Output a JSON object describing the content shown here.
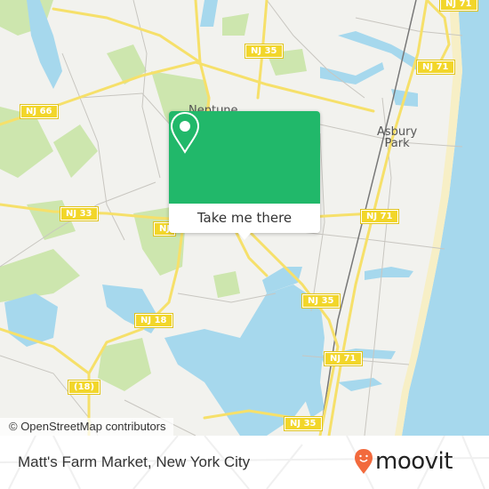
{
  "map": {
    "place_labels": [
      {
        "id": "neptune",
        "text": "Neptune"
      },
      {
        "id": "asbury-park",
        "text": "Asbury\nPark"
      }
    ],
    "route_shields": [
      {
        "id": "nj71-top",
        "text": "NJ 71"
      },
      {
        "id": "nj35-top",
        "text": "NJ 35"
      },
      {
        "id": "nj66",
        "text": "NJ 66"
      },
      {
        "id": "nj71-upper",
        "text": "NJ 71"
      },
      {
        "id": "nj33",
        "text": "NJ 33"
      },
      {
        "id": "nj-partial",
        "text": "NJ"
      },
      {
        "id": "nj71-mid",
        "text": "NJ 71"
      },
      {
        "id": "nj35-mid",
        "text": "NJ 35"
      },
      {
        "id": "nj18",
        "text": "NJ 18"
      },
      {
        "id": "nj71-lower",
        "text": "NJ 71"
      },
      {
        "id": "us18",
        "text": "(18)"
      },
      {
        "id": "nj35-bottom",
        "text": "NJ 35"
      }
    ],
    "attribution": "© OpenStreetMap contributors",
    "colors": {
      "land": "#f2f2ee",
      "water": "#a6d8ed",
      "park": "#cde6ae",
      "highway": "#f6e06a",
      "beach": "#f7efc6"
    }
  },
  "popup": {
    "action_label": "Take me there",
    "icon": "map-pin-icon",
    "color": "#21b86a"
  },
  "footer": {
    "place_title": "Matt's Farm Market, New York City",
    "brand": "moovit",
    "brand_color": "#f26a3d"
  }
}
